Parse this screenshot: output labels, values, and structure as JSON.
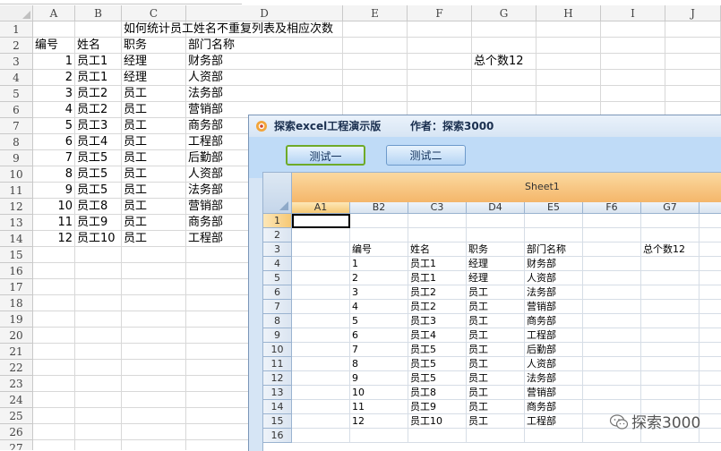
{
  "sheet": {
    "columns": [
      "A",
      "B",
      "C",
      "D",
      "E",
      "F",
      "G",
      "H",
      "I",
      "J"
    ],
    "rows": [
      "1",
      "2",
      "3",
      "4",
      "5",
      "6",
      "7",
      "8",
      "9",
      "10",
      "11",
      "12",
      "13",
      "14",
      "15",
      "16",
      "17",
      "18",
      "19",
      "20",
      "21",
      "22",
      "23",
      "24",
      "25",
      "26",
      "27"
    ],
    "title": "如何统计员工姓名不重复列表及相应次数",
    "headers": [
      "编号",
      "姓名",
      "职务",
      "部门名称"
    ],
    "total_label": "总个数12",
    "data": [
      [
        "1",
        "员工1",
        "经理",
        "财务部"
      ],
      [
        "2",
        "员工1",
        "经理",
        "人资部"
      ],
      [
        "3",
        "员工2",
        "员工",
        "法务部"
      ],
      [
        "4",
        "员工2",
        "员工",
        "营销部"
      ],
      [
        "5",
        "员工3",
        "员工",
        "商务部"
      ],
      [
        "6",
        "员工4",
        "员工",
        "工程部"
      ],
      [
        "7",
        "员工5",
        "员工",
        "后勤部"
      ],
      [
        "8",
        "员工5",
        "员工",
        "人资部"
      ],
      [
        "9",
        "员工5",
        "员工",
        "法务部"
      ],
      [
        "10",
        "员工8",
        "员工",
        "营销部"
      ],
      [
        "11",
        "员工9",
        "员工",
        "商务部"
      ],
      [
        "12",
        "员工10",
        "员工",
        "工程部"
      ]
    ]
  },
  "window": {
    "title": "探索excel工程演示版",
    "author": "作者：探索3000",
    "buttons": [
      "测试一",
      "测试二"
    ]
  },
  "inner": {
    "sheet_name": "Sheet1",
    "columns": [
      "A1",
      "B2",
      "C3",
      "D4",
      "E5",
      "F6",
      "G7"
    ],
    "rows": [
      "1",
      "2",
      "3",
      "4",
      "5",
      "6",
      "7",
      "8",
      "9",
      "10",
      "11",
      "12",
      "13",
      "14",
      "15",
      "16"
    ],
    "headers": [
      "编号",
      "姓名",
      "职务",
      "部门名称"
    ],
    "total_label": "总个数12"
  },
  "watermark": "探索3000"
}
